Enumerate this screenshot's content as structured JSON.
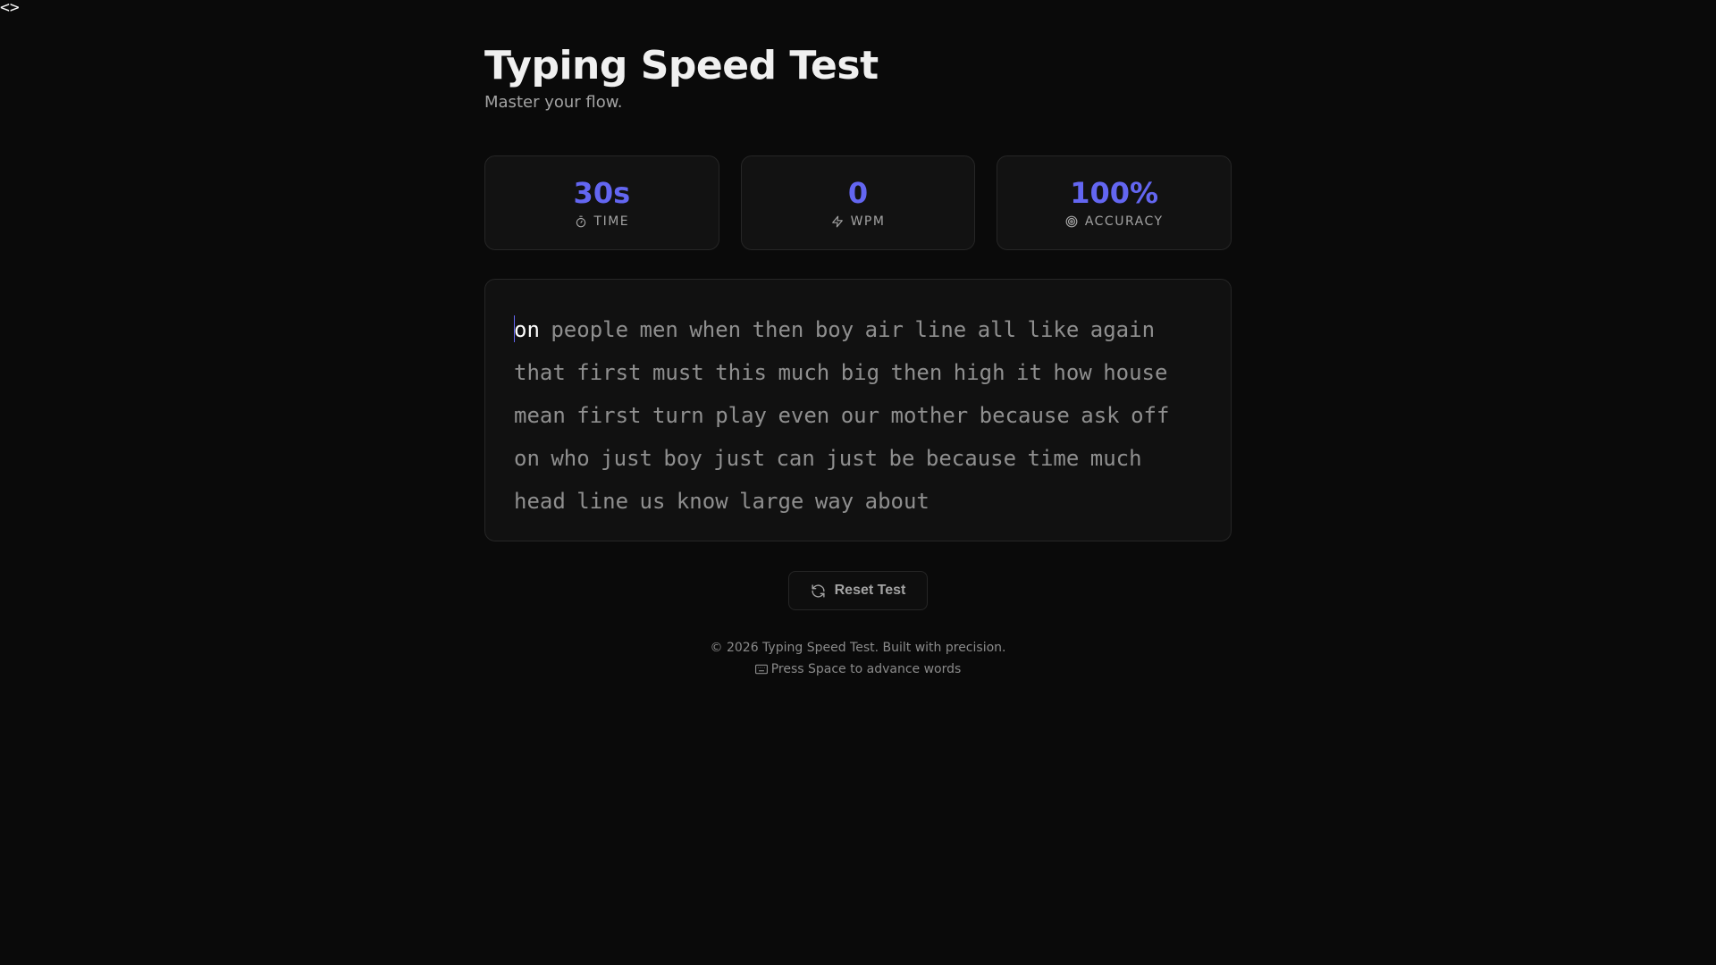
{
  "corner_mark": "<>",
  "header": {
    "title": "Typing Speed Test",
    "subtitle": "Master your flow."
  },
  "stats": {
    "time": {
      "value": "30s",
      "label": "TIME",
      "icon": "timer-icon"
    },
    "wpm": {
      "value": "0",
      "label": "WPM",
      "icon": "lightning-icon"
    },
    "accuracy": {
      "value": "100%",
      "label": "ACCURACY",
      "icon": "target-icon"
    }
  },
  "accent_color": "#6366f1",
  "text_panel": {
    "active_word_index": 0,
    "words": [
      "on",
      "people",
      "men",
      "when",
      "then",
      "boy",
      "air",
      "line",
      "all",
      "like",
      "again",
      "that",
      "first",
      "must",
      "this",
      "much",
      "big",
      "then",
      "high",
      "it",
      "how",
      "house",
      "mean",
      "first",
      "turn",
      "play",
      "even",
      "our",
      "mother",
      "because",
      "ask",
      "off",
      "on",
      "who",
      "just",
      "boy",
      "just",
      "can",
      "just",
      "be",
      "because",
      "time",
      "much",
      "head",
      "line",
      "us",
      "know",
      "large",
      "way",
      "about"
    ]
  },
  "actions": {
    "reset_label": "Reset Test",
    "reset_icon": "refresh-icon"
  },
  "footer": {
    "copyright": "© 2026 Typing Speed Test. Built with precision.",
    "hint": "Press Space to advance words",
    "hint_icon": "keyboard-icon"
  }
}
